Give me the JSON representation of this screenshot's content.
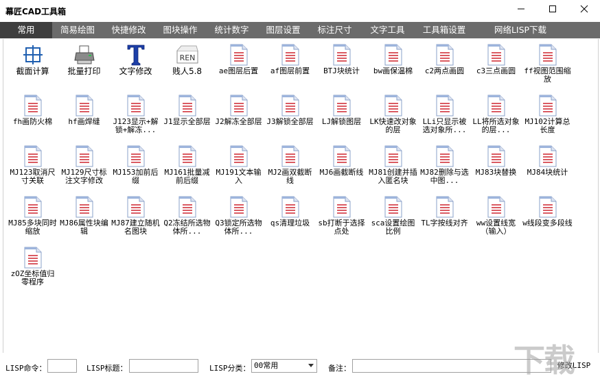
{
  "window": {
    "title": "幕匠CAD工具箱"
  },
  "tabs": [
    {
      "label": "常用",
      "active": true
    },
    {
      "label": "简易绘图"
    },
    {
      "label": "快捷修改"
    },
    {
      "label": "图块操作"
    },
    {
      "label": "统计数字"
    },
    {
      "label": "图层设置"
    },
    {
      "label": "标注尺寸"
    },
    {
      "label": "文字工具"
    },
    {
      "label": "工具箱设置"
    },
    {
      "label": "网络LISP下载"
    }
  ],
  "items": [
    {
      "label": "截面计算",
      "icon": "crosshair-icon"
    },
    {
      "label": "批量打印",
      "icon": "printer-icon"
    },
    {
      "label": "文字修改",
      "icon": "text-t-icon"
    },
    {
      "label": "贱人5.8",
      "icon": "ren-icon"
    },
    {
      "label": "ae图层后置",
      "icon": "document-icon"
    },
    {
      "label": "af图层前置",
      "icon": "document-icon"
    },
    {
      "label": "BTJ块统计",
      "icon": "document-icon"
    },
    {
      "label": "bw画保温棉",
      "icon": "document-icon"
    },
    {
      "label": "c2两点画圆",
      "icon": "document-icon"
    },
    {
      "label": "c3三点画圆",
      "icon": "document-icon"
    },
    {
      "label": "ff视图范围缩放",
      "icon": "document-icon"
    },
    {
      "label": "fh画防火棉",
      "icon": "document-icon"
    },
    {
      "label": "hf画焊缝",
      "icon": "document-icon"
    },
    {
      "label": "J123显示+解锁+解冻...",
      "icon": "document-icon"
    },
    {
      "label": "J1显示全部层",
      "icon": "document-icon"
    },
    {
      "label": "J2解冻全部层",
      "icon": "document-icon"
    },
    {
      "label": "J3解锁全部层",
      "icon": "document-icon"
    },
    {
      "label": "LJ解锁图层",
      "icon": "document-icon"
    },
    {
      "label": "LK快速改对象的层",
      "icon": "document-icon"
    },
    {
      "label": "LLi只显示被选对象所...",
      "icon": "document-icon"
    },
    {
      "label": "LL将所选对象的层...",
      "icon": "document-icon"
    },
    {
      "label": "MJ102计算总长度",
      "icon": "document-icon"
    },
    {
      "label": "MJ123取消尺寸关联",
      "icon": "document-icon"
    },
    {
      "label": "MJ129尺寸标注文字修改",
      "icon": "document-icon"
    },
    {
      "label": "MJ153加前后缀",
      "icon": "document-icon"
    },
    {
      "label": "MJ161批量减前后缀",
      "icon": "document-icon"
    },
    {
      "label": "MJ191文本输入",
      "icon": "document-icon"
    },
    {
      "label": "MJ2画双截断线",
      "icon": "document-icon"
    },
    {
      "label": "MJ6画截断线",
      "icon": "document-icon"
    },
    {
      "label": "MJ81创建并插入匿名块",
      "icon": "document-icon"
    },
    {
      "label": "MJ82删除与选中图...",
      "icon": "document-icon"
    },
    {
      "label": "MJ83块替换",
      "icon": "document-icon"
    },
    {
      "label": "MJ84块统计",
      "icon": "document-icon"
    },
    {
      "label": "MJ85多块同时缩放",
      "icon": "document-icon"
    },
    {
      "label": "MJ86属性块编辑",
      "icon": "document-icon"
    },
    {
      "label": "MJ87建立随机名图块",
      "icon": "document-icon"
    },
    {
      "label": "Q2冻结所选物体所...",
      "icon": "document-icon"
    },
    {
      "label": "Q3锁定所选物体所...",
      "icon": "document-icon"
    },
    {
      "label": "qs清理垃圾",
      "icon": "document-icon"
    },
    {
      "label": "sb打断于选择点处",
      "icon": "document-icon"
    },
    {
      "label": "sca设置绘图比例",
      "icon": "document-icon"
    },
    {
      "label": "TL字按线对齐",
      "icon": "document-icon"
    },
    {
      "label": "ww设置线宽（输入）",
      "icon": "document-icon"
    },
    {
      "label": "w线段变多段线",
      "icon": "document-icon"
    },
    {
      "label": "zOZ坐标值归零程序",
      "icon": "document-icon"
    }
  ],
  "bottom": {
    "command_label": "LISP命令：",
    "command_value": "",
    "title_label": "LISP标题：",
    "title_value": "",
    "category_label": "LISP分类：",
    "category_value": "00常用",
    "note_label": "备注：",
    "note_value": "",
    "modify_button": "修改LISP"
  },
  "watermark": "下载"
}
